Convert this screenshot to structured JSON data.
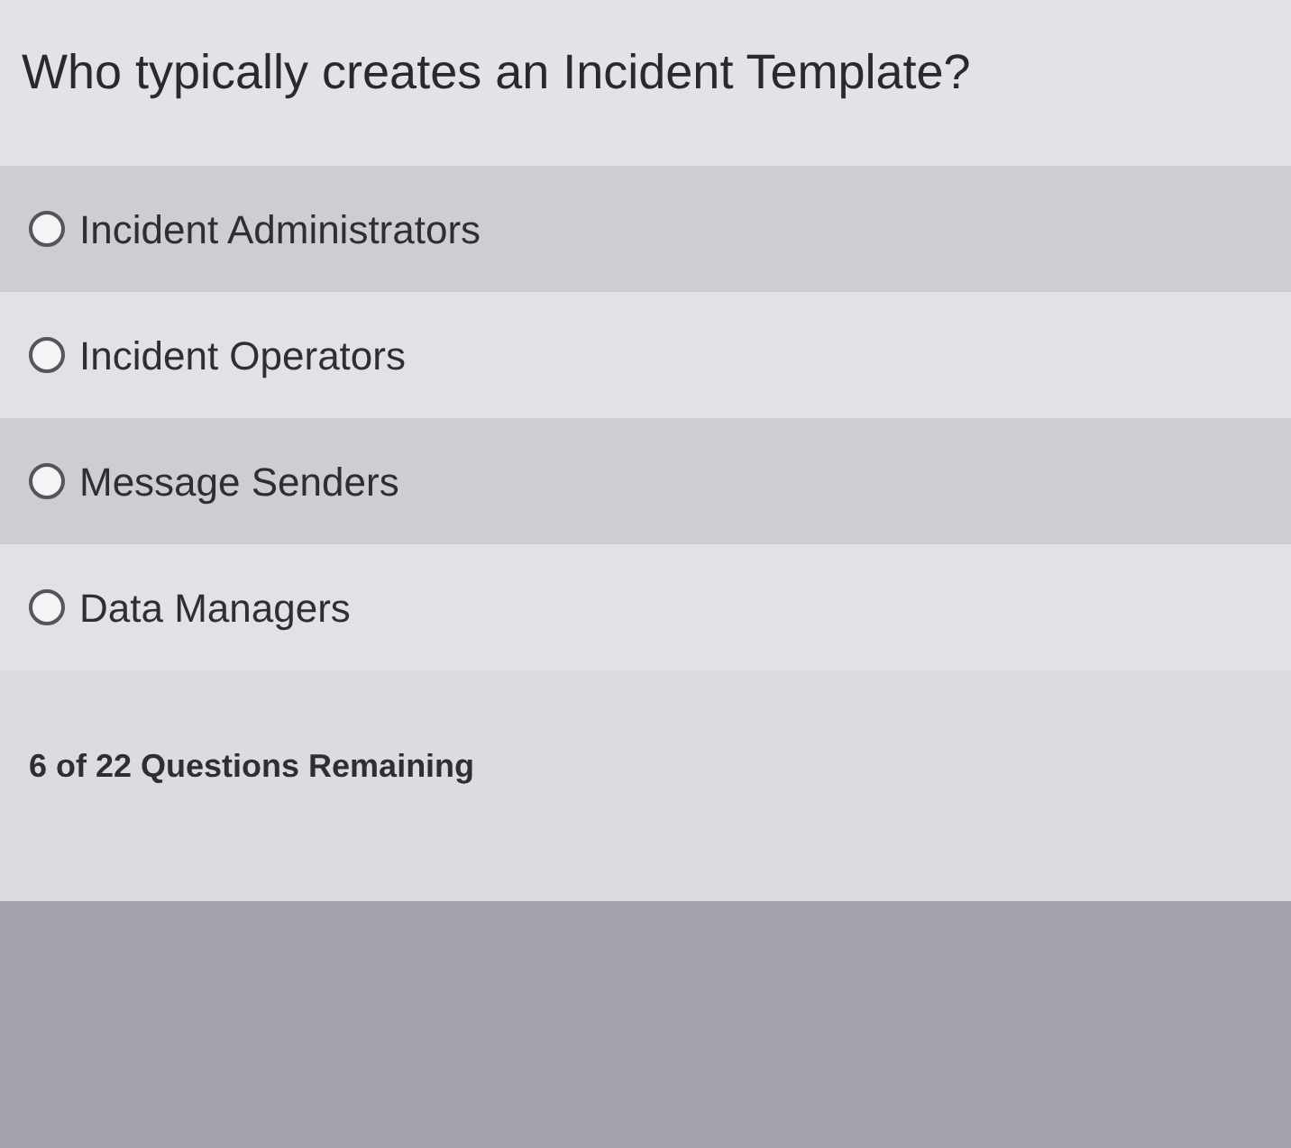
{
  "question": "Who typically creates an Incident Template?",
  "options": [
    {
      "label": "Incident Administrators",
      "selected": false
    },
    {
      "label": "Incident Operators",
      "selected": false
    },
    {
      "label": "Message Senders",
      "selected": false
    },
    {
      "label": "Data Managers",
      "selected": false
    }
  ],
  "progress": "6 of 22 Questions Remaining"
}
